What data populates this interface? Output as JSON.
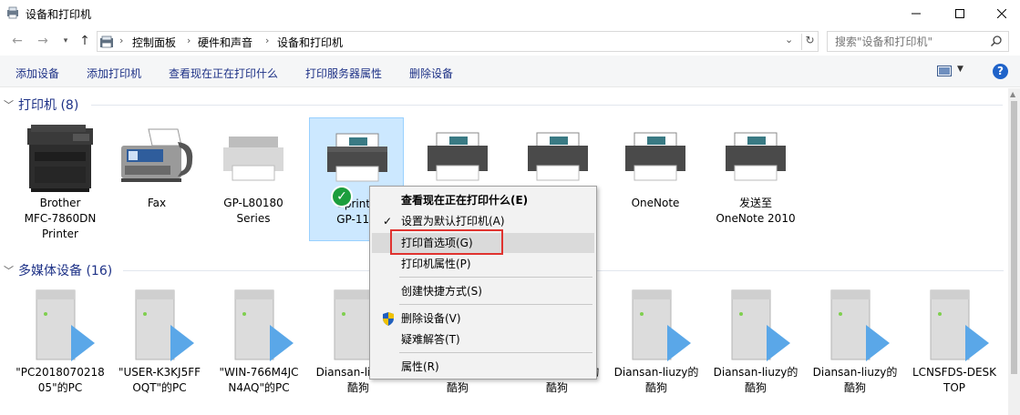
{
  "window": {
    "title": "设备和打印机"
  },
  "nav": {
    "breadcrumbs": [
      "控制面板",
      "硬件和声音",
      "设备和打印机"
    ],
    "search_placeholder": "搜索\"设备和打印机\""
  },
  "commands": [
    "添加设备",
    "添加打印机",
    "查看现在正在打印什么",
    "打印服务器属性",
    "删除设备"
  ],
  "groups": {
    "printers": {
      "title": "打印机 (8)"
    },
    "media": {
      "title": "多媒体设备 (16)"
    }
  },
  "printers": [
    {
      "label": "Brother\nMFC-7860DN\nPrinter",
      "icon": "mfp-printer-icon"
    },
    {
      "label": "Fax",
      "icon": "fax-icon"
    },
    {
      "label": "GP-L80180\nSeries",
      "icon": "printer-icon"
    },
    {
      "label": "Gprinte\nGP-112",
      "icon": "printer-icon",
      "selected": true,
      "default": true
    },
    {
      "label": "",
      "icon": "printer-icon"
    },
    {
      "label": "",
      "icon": "printer-icon"
    },
    {
      "label": "OneNote",
      "icon": "printer-icon"
    },
    {
      "label": "发送至\nOneNote 2010",
      "icon": "printer-icon"
    }
  ],
  "media": [
    {
      "label": "\"PC2018070218\n05\"的PC"
    },
    {
      "label": "\"USER-K3KJ5FF\nOQT\"的PC"
    },
    {
      "label": "\"WIN-766M4JC\nN4AQ\"的PC"
    },
    {
      "label": "Diansan-liuzy的\n酷狗"
    },
    {
      "label": "Diansan-liuzy的\n酷狗"
    },
    {
      "label": "Diansan-liuzy的\n酷狗"
    },
    {
      "label": "Diansan-liuzy的\n酷狗"
    },
    {
      "label": "Diansan-liuzy的\n酷狗"
    },
    {
      "label": "Diansan-liuzy的\n酷狗"
    },
    {
      "label": "LCNSFDS-DESK\nTOP"
    }
  ],
  "context_menu": {
    "items": [
      {
        "label": "查看现在正在打印什么(E)",
        "bold": true
      },
      {
        "label": "设置为默认打印机(A)",
        "checked": true
      },
      {
        "label": "打印首选项(G)",
        "highlighted": true
      },
      {
        "label": "打印机属性(P)"
      },
      {
        "label": "创建快捷方式(S)"
      },
      {
        "label": "删除设备(V)",
        "shield": true
      },
      {
        "label": "疑难解答(T)"
      },
      {
        "label": "属性(R)"
      }
    ]
  },
  "colors": {
    "accent": "#1e3287",
    "selection": "#cce8ff",
    "highlight_box": "#e0332f",
    "default_check": "#1c9e3d"
  }
}
